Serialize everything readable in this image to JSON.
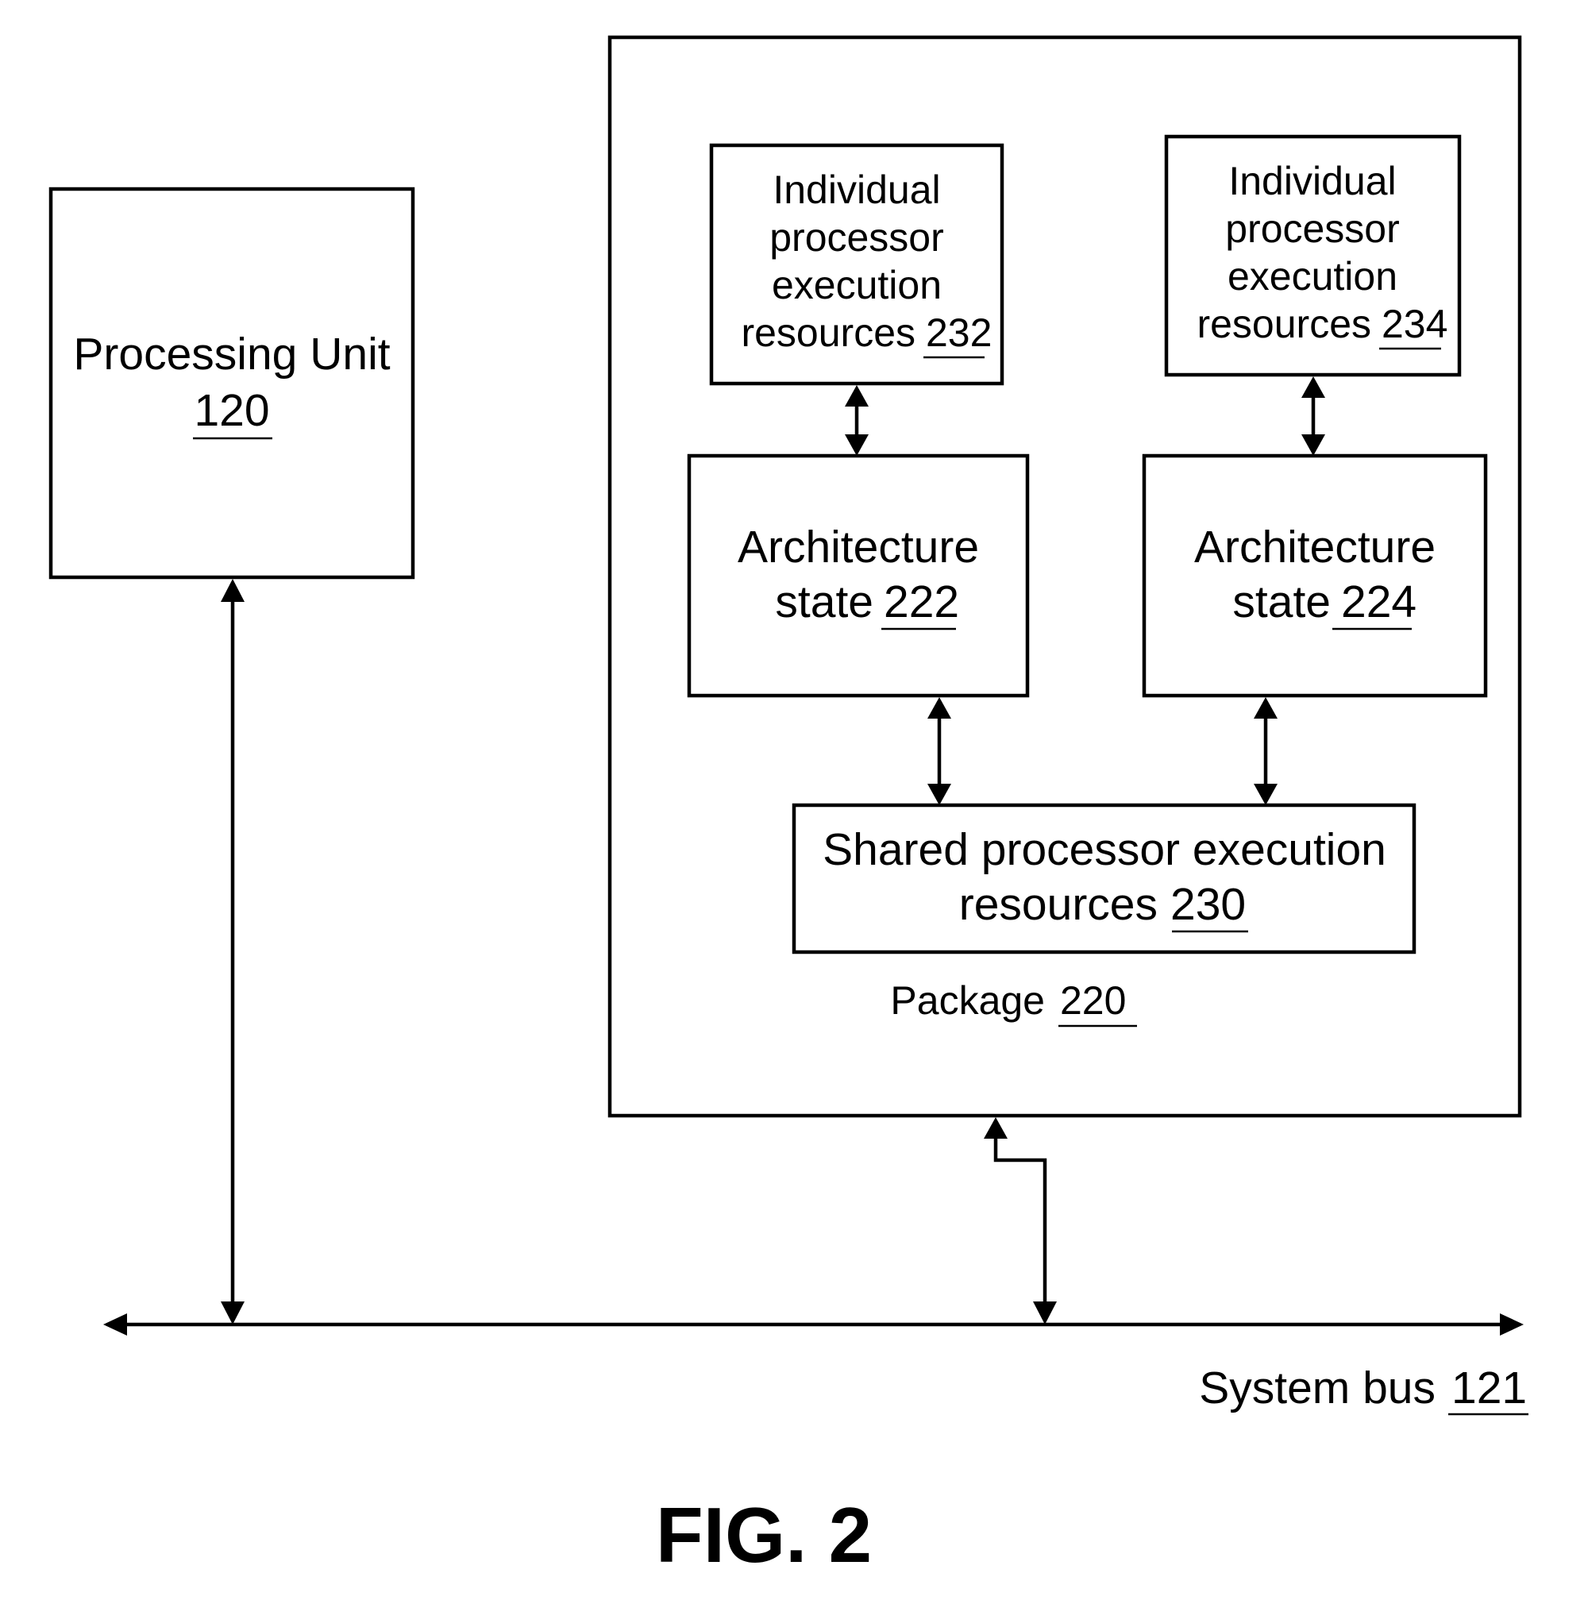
{
  "figure": {
    "caption": "FIG. 2"
  },
  "processing_unit": {
    "name": "Processing Unit",
    "ref": "120"
  },
  "package": {
    "name": "Package",
    "ref": "220",
    "individual_232": {
      "lines": [
        "Individual",
        "processor",
        "execution",
        "resources"
      ],
      "ref": "232"
    },
    "individual_234": {
      "lines": [
        "Individual",
        "processor",
        "execution",
        "resources"
      ],
      "ref": "234"
    },
    "arch_222": {
      "lines": [
        "Architecture",
        "state"
      ],
      "ref": "222"
    },
    "arch_224": {
      "lines": [
        "Architecture",
        "state"
      ],
      "ref": "224"
    },
    "shared_230": {
      "lines": [
        "Shared processor execution",
        "resources"
      ],
      "ref": "230"
    }
  },
  "system_bus": {
    "name": "System bus",
    "ref": "121"
  },
  "connections": [
    {
      "from": "individual_232",
      "to": "arch_222",
      "type": "bidirectional"
    },
    {
      "from": "individual_234",
      "to": "arch_224",
      "type": "bidirectional"
    },
    {
      "from": "arch_222",
      "to": "shared_230",
      "type": "bidirectional"
    },
    {
      "from": "arch_224",
      "to": "shared_230",
      "type": "bidirectional"
    },
    {
      "from": "processing_unit",
      "to": "system_bus",
      "type": "bidirectional"
    },
    {
      "from": "package",
      "to": "system_bus",
      "type": "bidirectional"
    }
  ]
}
